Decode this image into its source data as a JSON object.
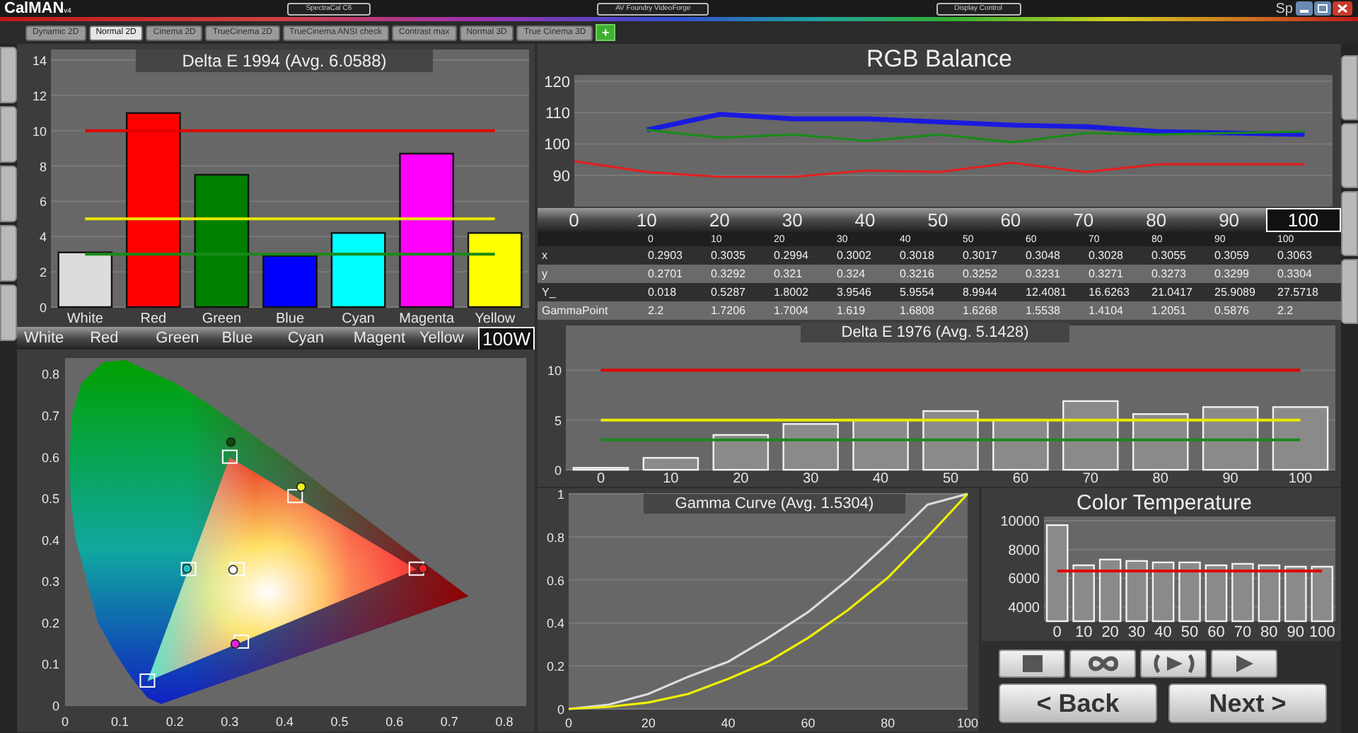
{
  "app": {
    "logo": "CalMAN",
    "version": "v4",
    "devices": [
      {
        "label": "SpectraCal C6"
      },
      {
        "label": "AV Foundry VideoForge"
      },
      {
        "label": "Display Control"
      }
    ],
    "corner_text": "Sp"
  },
  "preset_tabs": [
    {
      "label": "Dynamic 2D",
      "selected": false
    },
    {
      "label": "Normal 2D",
      "selected": true
    },
    {
      "label": "Cinema 2D",
      "selected": false
    },
    {
      "label": "TrueCinema 2D",
      "selected": false
    },
    {
      "label": "TrueCinema ANSI check",
      "selected": false
    },
    {
      "label": "Contrast max",
      "selected": false
    },
    {
      "label": "Normal 3D",
      "selected": false
    },
    {
      "label": "True Cinema 3D",
      "selected": false
    }
  ],
  "add_tab": "+",
  "delta_e_1994": {
    "title": "Delta E 1994 (Avg. 6.0588)",
    "chart_data": {
      "type": "bar",
      "stacked": true,
      "grid": true,
      "categories": [
        "White",
        "Red",
        "Green",
        "Blue",
        "Cyan",
        "Magenta",
        "Yellow"
      ],
      "series": [
        {
          "color": "#dcdcdc",
          "values": [
            3.1,
            null,
            null,
            null,
            null,
            null,
            null
          ]
        },
        {
          "color": "#ff0000",
          "values": [
            null,
            11,
            null,
            null,
            null,
            null,
            null
          ]
        },
        {
          "color": "#008000",
          "values": [
            null,
            null,
            7.5,
            null,
            null,
            null,
            null
          ]
        },
        {
          "color": "#0000ff",
          "values": [
            null,
            null,
            null,
            2.9,
            null,
            null,
            null
          ]
        },
        {
          "color": "#00ffff",
          "values": [
            null,
            null,
            null,
            null,
            4.2,
            null,
            null
          ]
        },
        {
          "color": "#ff00ff",
          "values": [
            null,
            null,
            null,
            null,
            null,
            8.7,
            null
          ]
        },
        {
          "color": "#ffff00",
          "values": [
            null,
            null,
            null,
            null,
            null,
            null,
            4.2
          ]
        }
      ],
      "ylim": [
        0,
        14.6
      ],
      "yticks": [
        0,
        2,
        4,
        6,
        8,
        10,
        12,
        14
      ],
      "ref_lines": [
        {
          "axis": "y",
          "value": 10,
          "color": "#e00000"
        },
        {
          "axis": "y",
          "value": 5,
          "color": "#e8e800"
        },
        {
          "axis": "y",
          "value": 3,
          "color": "#1a8a1a"
        }
      ]
    }
  },
  "color_selector": [
    {
      "label": "White",
      "selected": false
    },
    {
      "label": "Red",
      "selected": false
    },
    {
      "label": "Green",
      "selected": false
    },
    {
      "label": "Blue",
      "selected": false
    },
    {
      "label": "Cyan",
      "selected": false
    },
    {
      "label": "Magent",
      "selected": false
    },
    {
      "label": "Yellow",
      "selected": false
    },
    {
      "label": "100W",
      "selected": true
    }
  ],
  "cie": {
    "x_labels": [
      "0",
      "0.1",
      "0.2",
      "0.3",
      "0.4",
      "0.5",
      "0.6",
      "0.7",
      "0.8"
    ],
    "y_labels": [
      "0.8",
      "0.7",
      "0.6",
      "0.5",
      "0.4",
      "0.3",
      "0.2",
      "0.1",
      "0"
    ]
  },
  "rgb_balance": {
    "title": "RGB Balance",
    "chart_data": {
      "type": "line",
      "grid": true,
      "x": [
        0,
        10,
        20,
        30,
        40,
        50,
        60,
        70,
        80,
        90,
        100
      ],
      "ylim": [
        80,
        122
      ],
      "yticks": [
        90,
        100,
        110,
        120
      ],
      "series": [
        {
          "color": "#e02020",
          "values": [
            94.5,
            91,
            89.5,
            89.5,
            91.5,
            91,
            94,
            91,
            93.5,
            93.5,
            93.5
          ]
        },
        {
          "color": "#1a8a1a",
          "values": [
            null,
            104.5,
            102,
            103,
            101,
            103,
            100.5,
            103.5,
            103,
            103.5,
            104
          ]
        },
        {
          "color": "#1a1ae0",
          "values": [
            null,
            104.5,
            109.5,
            108,
            108,
            107,
            106,
            105.5,
            104,
            103.5,
            103
          ]
        }
      ]
    }
  },
  "level_selector": [
    {
      "label": "0",
      "selected": false
    },
    {
      "label": "10",
      "selected": false
    },
    {
      "label": "20",
      "selected": false
    },
    {
      "label": "30",
      "selected": false
    },
    {
      "label": "40",
      "selected": false
    },
    {
      "label": "50",
      "selected": false
    },
    {
      "label": "60",
      "selected": false
    },
    {
      "label": "70",
      "selected": false
    },
    {
      "label": "80",
      "selected": false
    },
    {
      "label": "90",
      "selected": false
    },
    {
      "label": "100",
      "selected": true
    }
  ],
  "measurements": {
    "columns": [
      "0",
      "10",
      "20",
      "30",
      "40",
      "50",
      "60",
      "70",
      "80",
      "90",
      "100"
    ],
    "rows": [
      {
        "label": "x",
        "values": [
          "0.2903",
          "0.3035",
          "0.2994",
          "0.3002",
          "0.3018",
          "0.3017",
          "0.3048",
          "0.3028",
          "0.3055",
          "0.3059",
          "0.3063"
        ]
      },
      {
        "label": "y",
        "values": [
          "0.2701",
          "0.3292",
          "0.321",
          "0.324",
          "0.3216",
          "0.3252",
          "0.3231",
          "0.3271",
          "0.3273",
          "0.3299",
          "0.3304"
        ]
      },
      {
        "label": "Y_",
        "values": [
          "0.018",
          "0.5287",
          "1.8002",
          "3.9546",
          "5.9554",
          "8.9944",
          "12.4081",
          "16.6263",
          "21.0417",
          "25.9089",
          "27.5718"
        ]
      },
      {
        "label": "GammaPoint",
        "values": [
          "2.2",
          "1.7206",
          "1.7004",
          "1.619",
          "1.6808",
          "1.6268",
          "1.5538",
          "1.4104",
          "1.2051",
          "0.5876",
          "2.2"
        ]
      }
    ]
  },
  "delta_e_1976": {
    "title": "Delta E 1976 (Avg. 5.1428)",
    "chart_data": {
      "type": "bar",
      "grid": true,
      "categories": [
        "0",
        "10",
        "20",
        "30",
        "40",
        "50",
        "60",
        "70",
        "80",
        "90",
        "100"
      ],
      "series": [
        {
          "color": "#8a8a8a",
          "values": [
            0.2,
            1.2,
            3.5,
            4.6,
            5,
            5.9,
            5,
            6.9,
            5.6,
            6.3,
            6.3
          ]
        }
      ],
      "ylim": [
        0,
        14.5
      ],
      "yticks": [
        0,
        5,
        10
      ],
      "ref_lines": [
        {
          "axis": "y",
          "value": 10,
          "color": "#e00000"
        },
        {
          "axis": "y",
          "value": 5,
          "color": "#e8e800"
        },
        {
          "axis": "y",
          "value": 3,
          "color": "#1a8a1a"
        }
      ]
    }
  },
  "gamma": {
    "title": "Gamma Curve (Avg. 1.5304)",
    "chart_data": {
      "type": "line",
      "grid": true,
      "x": [
        0,
        10,
        20,
        30,
        40,
        50,
        60,
        70,
        80,
        90,
        100
      ],
      "xlim": [
        0,
        100
      ],
      "ylim": [
        0,
        1
      ],
      "xticks": [
        0,
        20,
        40,
        60,
        80,
        100
      ],
      "yticks": [
        0,
        0.2,
        0.4,
        0.6,
        0.8,
        1
      ],
      "series": [
        {
          "color": "#dcdcdc",
          "values": [
            0,
            0.02,
            0.07,
            0.15,
            0.22,
            0.33,
            0.45,
            0.6,
            0.77,
            0.95,
            1
          ]
        },
        {
          "color": "#f0f000",
          "values": [
            0,
            0.01,
            0.03,
            0.07,
            0.14,
            0.22,
            0.33,
            0.46,
            0.61,
            0.8,
            1
          ]
        }
      ]
    }
  },
  "color_temperature": {
    "title": "Color Temperature",
    "chart_data": {
      "type": "bar",
      "grid": true,
      "categories": [
        "0",
        "10",
        "20",
        "30",
        "40",
        "50",
        "60",
        "70",
        "80",
        "90",
        "100"
      ],
      "series": [
        {
          "color": "#8a8a8a",
          "values": [
            9700,
            6900,
            7300,
            7200,
            7100,
            7100,
            6900,
            7000,
            6900,
            6800,
            6800
          ]
        }
      ],
      "ylim": [
        3000,
        10300
      ],
      "yticks": [
        4000,
        6000,
        8000,
        10000
      ],
      "ref_lines": [
        {
          "axis": "y",
          "value": 6500,
          "color": "#e00000"
        }
      ]
    }
  },
  "transport_buttons": [
    {
      "kind": "stop"
    },
    {
      "kind": "loop"
    },
    {
      "kind": "play_loop"
    },
    {
      "kind": "play"
    }
  ],
  "nav_buttons": [
    {
      "label": "< Back"
    },
    {
      "label": "Next >"
    }
  ]
}
